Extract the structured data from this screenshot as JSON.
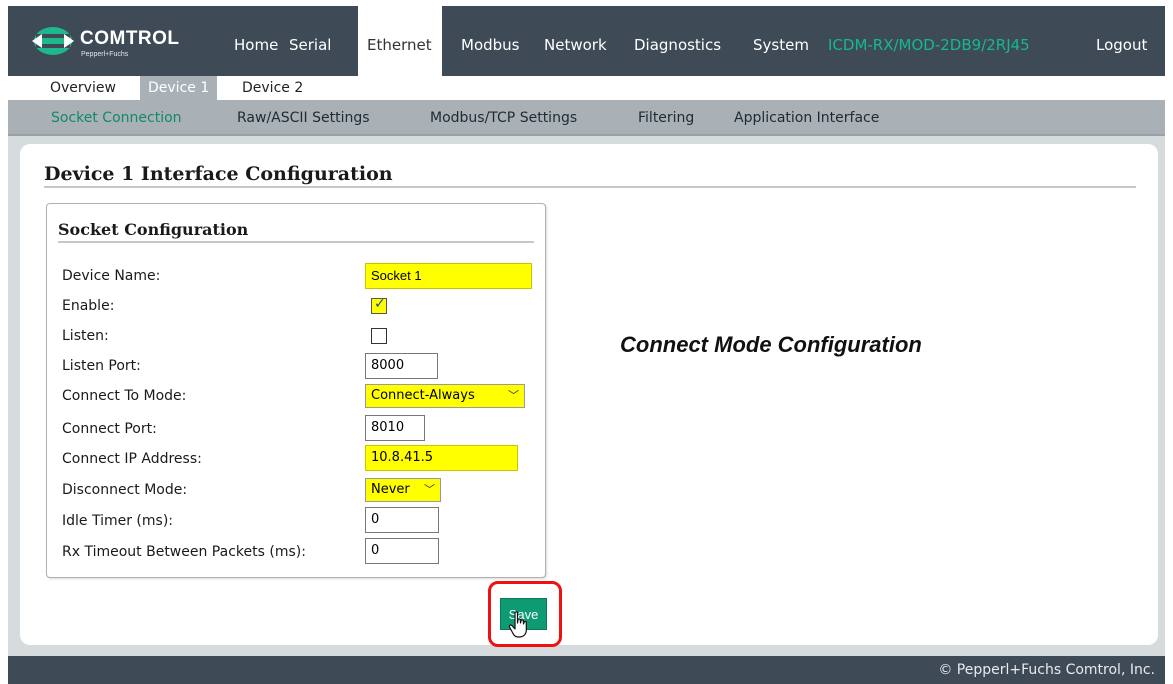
{
  "header": {
    "brand": "COMTROL",
    "brand_sub": "Pepperl+Fuchs",
    "nav": {
      "home": "Home",
      "serial": "Serial",
      "ethernet": "Ethernet",
      "modbus": "Modbus",
      "network": "Network",
      "diagnostics": "Diagnostics",
      "system": "System",
      "model": "ICDM-RX/MOD-2DB9/2RJ45",
      "logout": "Logout"
    },
    "active": "Ethernet"
  },
  "subnav": {
    "overview": "Overview",
    "device1": "Device 1",
    "device2": "Device 2",
    "active": "Device 1"
  },
  "thirdnav": {
    "socket": "Socket Connection",
    "raw": "Raw/ASCII Settings",
    "modbus_tcp": "Modbus/TCP Settings",
    "filtering": "Filtering",
    "app_iface": "Application Interface",
    "active": "Socket Connection"
  },
  "page": {
    "title": "Device 1 Interface Configuration"
  },
  "socket_config": {
    "title": "Socket Configuration",
    "device_name": {
      "label": "Device Name:",
      "value": "Socket 1"
    },
    "enable": {
      "label": "Enable:",
      "checked": true
    },
    "listen": {
      "label": "Listen:",
      "checked": false
    },
    "listen_port": {
      "label": "Listen Port:",
      "value": "8000"
    },
    "connect_mode": {
      "label": "Connect To Mode:",
      "value": "Connect-Always"
    },
    "connect_port": {
      "label": "Connect Port:",
      "value": "8010"
    },
    "connect_ip": {
      "label": "Connect IP Address:",
      "value": "10.8.41.5"
    },
    "disconnect_mode": {
      "label": "Disconnect Mode:",
      "value": "Never"
    },
    "idle_timer": {
      "label": "Idle Timer (ms):",
      "value": "0"
    },
    "rx_timeout": {
      "label": "Rx Timeout Between Packets (ms):",
      "value": "0"
    }
  },
  "annotation": "Connect Mode Configuration",
  "actions": {
    "save": "Save"
  },
  "footer": {
    "copyright": "© Pepperl+Fuchs Comtrol, Inc."
  },
  "colors": {
    "topbar": "#3e4a56",
    "accent": "#0e9a72",
    "highlight": "#ffff00",
    "subnav_bg": "#aab1b6",
    "callout_border": "#e11111"
  }
}
